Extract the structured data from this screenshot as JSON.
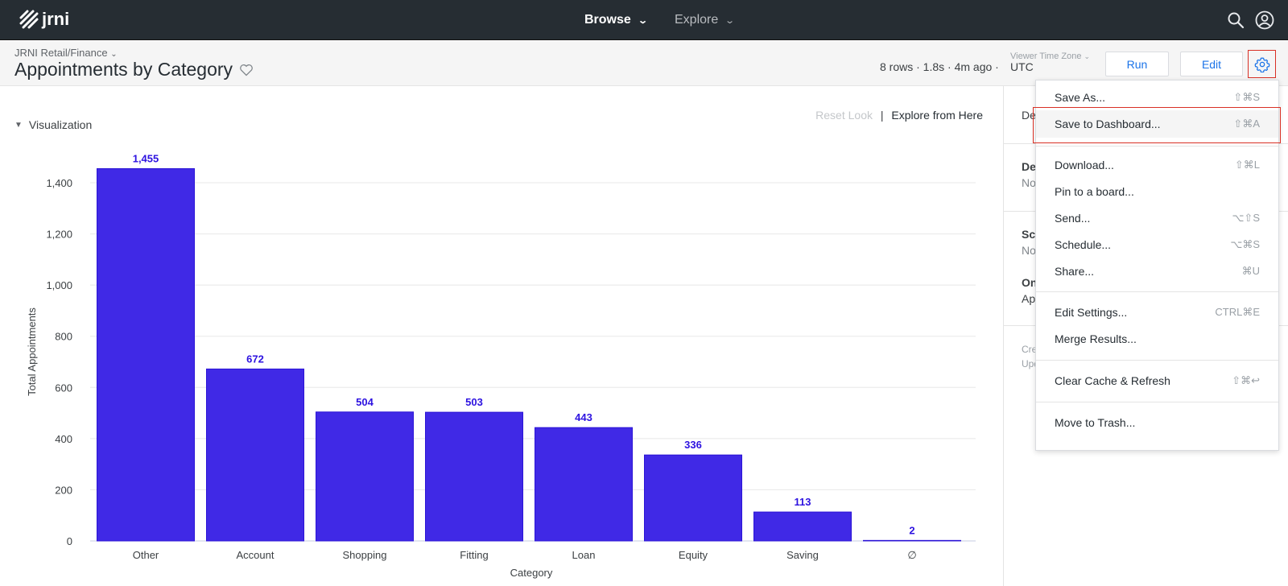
{
  "topbar": {
    "logo_text": "jrni",
    "nav": [
      {
        "label": "Browse",
        "active": true
      },
      {
        "label": "Explore",
        "active": false
      }
    ],
    "icons": [
      "search-icon",
      "account-icon"
    ]
  },
  "header": {
    "breadcrumb": "JRNI Retail/Finance",
    "title": "Appointments by Category",
    "meta": "8 rows · 1.8s · 4m ago · ",
    "timezone_label": "Viewer Time Zone",
    "timezone_value": "UTC",
    "run_label": "Run",
    "edit_label": "Edit"
  },
  "main": {
    "viz_toggle_label": "Visualization",
    "reset_look": "Reset Look",
    "separator": "|",
    "explore_from_here": "Explore from Here"
  },
  "side": {
    "sec1_label": "De",
    "sec2_label": "Des",
    "sec2_value": "Non",
    "sec3_label": "Sch",
    "sec3_value": "No",
    "sec4_label": "On",
    "sec4_value": "App",
    "created": "Cre",
    "updated": "Upd"
  },
  "menu": {
    "items": [
      {
        "label": "Save As...",
        "shortcut": "⇧⌘S"
      },
      {
        "label": "Save to Dashboard...",
        "shortcut": "⇧⌘A",
        "highlighted": true
      },
      {
        "label": "Download...",
        "shortcut": "⇧⌘L"
      },
      {
        "label": "Pin to a board...",
        "shortcut": ""
      },
      {
        "label": "Send...",
        "shortcut": "⌥⇧S"
      },
      {
        "label": "Schedule...",
        "shortcut": "⌥⌘S"
      },
      {
        "label": "Share...",
        "shortcut": "⌘U"
      },
      {
        "label": "Edit Settings...",
        "shortcut": "CTRL⌘E"
      },
      {
        "label": "Merge Results...",
        "shortcut": ""
      },
      {
        "label": "Clear Cache & Refresh",
        "shortcut": "⇧⌘↩"
      },
      {
        "label": "Move to Trash...",
        "shortcut": ""
      }
    ]
  },
  "colors": {
    "bar": "#4029e6",
    "label": "#2d12e0",
    "highlight": "#d93025",
    "accent": "#1a73e8"
  },
  "chart_data": {
    "type": "bar",
    "title": "",
    "categories": [
      "Other",
      "Account",
      "Shopping",
      "Fitting",
      "Loan",
      "Equity",
      "Saving",
      "∅"
    ],
    "values": [
      1455,
      672,
      504,
      503,
      443,
      336,
      113,
      2
    ],
    "value_labels": [
      "1,455",
      "672",
      "504",
      "503",
      "443",
      "336",
      "113",
      "2"
    ],
    "xlabel": "Category",
    "ylabel": "Total Appointments",
    "ylim": [
      0,
      1455
    ],
    "yticks": [
      0,
      200,
      400,
      600,
      800,
      1000,
      1200,
      1400
    ],
    "ytick_labels": [
      "0",
      "200",
      "400",
      "600",
      "800",
      "1,000",
      "1,200",
      "1,400"
    ],
    "grid": true,
    "legend": "none"
  }
}
